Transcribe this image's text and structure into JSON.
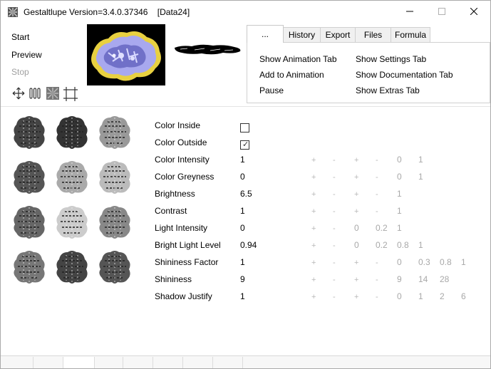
{
  "window": {
    "title": "Gestaltlupe Version=3.4.0.37346    [Data24]",
    "icon": "fractal-app-icon"
  },
  "controls": {
    "minimize_icon": "minimize-icon",
    "maximize_icon": "maximize-icon",
    "close_icon": "close-icon"
  },
  "left_menu": {
    "start": "Start",
    "preview": "Preview",
    "stop": "Stop"
  },
  "toolbar_icons": [
    "move-arrows-icon",
    "columns-icon",
    "fractal-icon",
    "crop-frame-icon"
  ],
  "tabs": [
    {
      "label": "...",
      "active": true
    },
    {
      "label": "History",
      "active": false
    },
    {
      "label": "Export",
      "active": false
    },
    {
      "label": "Files",
      "active": false
    },
    {
      "label": "Formula",
      "active": false
    }
  ],
  "tab_panel": {
    "show_animation_tab": "Show Animation Tab",
    "add_to_animation": "Add to Animation",
    "pause": "Pause",
    "show_settings_tab": "Show Settings Tab",
    "show_documentation_tab": "Show Documentation Tab",
    "show_extras_tab": "Show Extras Tab"
  },
  "properties": [
    {
      "label": "Color Inside",
      "value": "",
      "checkbox": true,
      "checked": false,
      "controls": []
    },
    {
      "label": "Color Outside",
      "value": "",
      "checkbox": true,
      "checked": true,
      "controls": []
    },
    {
      "label": "Color Intensity",
      "value": "1",
      "controls": [
        "+",
        "-",
        "+",
        "-",
        "0",
        "1"
      ]
    },
    {
      "label": "Color Greyness",
      "value": "0",
      "controls": [
        "+",
        "-",
        "+",
        "-",
        "0",
        "1"
      ]
    },
    {
      "label": "Brightness",
      "value": "6.5",
      "controls": [
        "+",
        "-",
        "+",
        "-",
        "1"
      ]
    },
    {
      "label": "Contrast",
      "value": "1",
      "controls": [
        "+",
        "-",
        "+",
        "-",
        "1"
      ]
    },
    {
      "label": "Light Intensity",
      "value": "0",
      "controls": [
        "+",
        "-",
        "0",
        "0.2",
        "1"
      ]
    },
    {
      "label": "Bright Light Level",
      "value": "0.94",
      "controls": [
        "+",
        "-",
        "0",
        "0.2",
        "0.8",
        "1"
      ]
    },
    {
      "label": "Shininess Factor",
      "value": "1",
      "controls": [
        "+",
        "-",
        "+",
        "-",
        "0",
        "0.3",
        "0.8",
        "1"
      ]
    },
    {
      "label": "Shininess",
      "value": "9",
      "controls": [
        "+",
        "-",
        "+",
        "-",
        "9",
        "14",
        "28"
      ]
    },
    {
      "label": "Shadow Justify",
      "value": "1",
      "controls": [
        "+",
        "-",
        "+",
        "-",
        "0",
        "1",
        "2",
        "6"
      ]
    }
  ],
  "colors": {
    "border": "#aaaaaa",
    "disabled_text": "#a0a0a0",
    "control_text": "#b8b8b8",
    "thumbnail_bg": "#000000",
    "fractal_blue": "#8a8ae0",
    "fractal_yellow": "#e8d040"
  }
}
